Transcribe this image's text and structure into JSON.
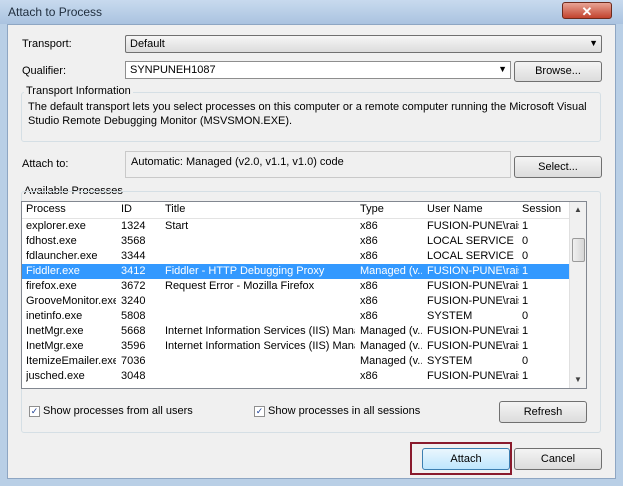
{
  "window": {
    "title": "Attach to Process",
    "close": "✕"
  },
  "transport": {
    "label": "Transport:",
    "value": "Default"
  },
  "qualifier": {
    "label": "Qualifier:",
    "value": "SYNPUNEH1087",
    "browse": "Browse..."
  },
  "transport_info": {
    "heading": "Transport Information",
    "text": "The default transport lets you select processes on this computer or a remote computer running the Microsoft Visual Studio Remote Debugging Monitor (MSVSMON.EXE)."
  },
  "attach_to": {
    "label": "Attach to:",
    "value": "Automatic: Managed (v2.0, v1.1, v1.0) code",
    "select": "Select..."
  },
  "processes": {
    "heading": "Available Processes",
    "columns": [
      "Process",
      "ID",
      "Title",
      "Type",
      "User Name",
      "Session"
    ],
    "rows": [
      [
        "explorer.exe",
        "1324",
        "Start",
        "x86",
        "FUSION-PUNE\\raisk",
        "1"
      ],
      [
        "fdhost.exe",
        "3568",
        "",
        "x86",
        "LOCAL SERVICE",
        "0"
      ],
      [
        "fdlauncher.exe",
        "3344",
        "",
        "x86",
        "LOCAL SERVICE",
        "0"
      ],
      [
        "Fiddler.exe",
        "3412",
        "Fiddler - HTTP Debugging Proxy",
        "Managed (v...",
        "FUSION-PUNE\\raisk",
        "1"
      ],
      [
        "firefox.exe",
        "3672",
        "Request Error - Mozilla Firefox",
        "x86",
        "FUSION-PUNE\\raisk",
        "1"
      ],
      [
        "GrooveMonitor.exe",
        "3240",
        "",
        "x86",
        "FUSION-PUNE\\raisk",
        "1"
      ],
      [
        "inetinfo.exe",
        "5808",
        "",
        "x86",
        "SYSTEM",
        "0"
      ],
      [
        "InetMgr.exe",
        "5668",
        "Internet Information Services (IIS) Manager",
        "Managed (v...",
        "FUSION-PUNE\\raisk",
        "1"
      ],
      [
        "InetMgr.exe",
        "3596",
        "Internet Information Services (IIS) Manager",
        "Managed (v...",
        "FUSION-PUNE\\raisk",
        "1"
      ],
      [
        "ItemizeEmailer.exe",
        "7036",
        "",
        "Managed (v...",
        "SYSTEM",
        "0"
      ],
      [
        "jusched.exe",
        "3048",
        "",
        "x86",
        "FUSION-PUNE\\raisk",
        "1"
      ],
      [
        "",
        "",
        "",
        "",
        "",
        ""
      ]
    ],
    "selected_index": 3,
    "show_all_users": "Show processes from all users",
    "show_all_sessions": "Show processes in all sessions",
    "refresh": "Refresh",
    "check_mark": "✓"
  },
  "footer": {
    "attach": "Attach",
    "cancel": "Cancel"
  },
  "colors": {
    "selection": "#3399ff",
    "highlight_border": "#8a1a2c"
  }
}
